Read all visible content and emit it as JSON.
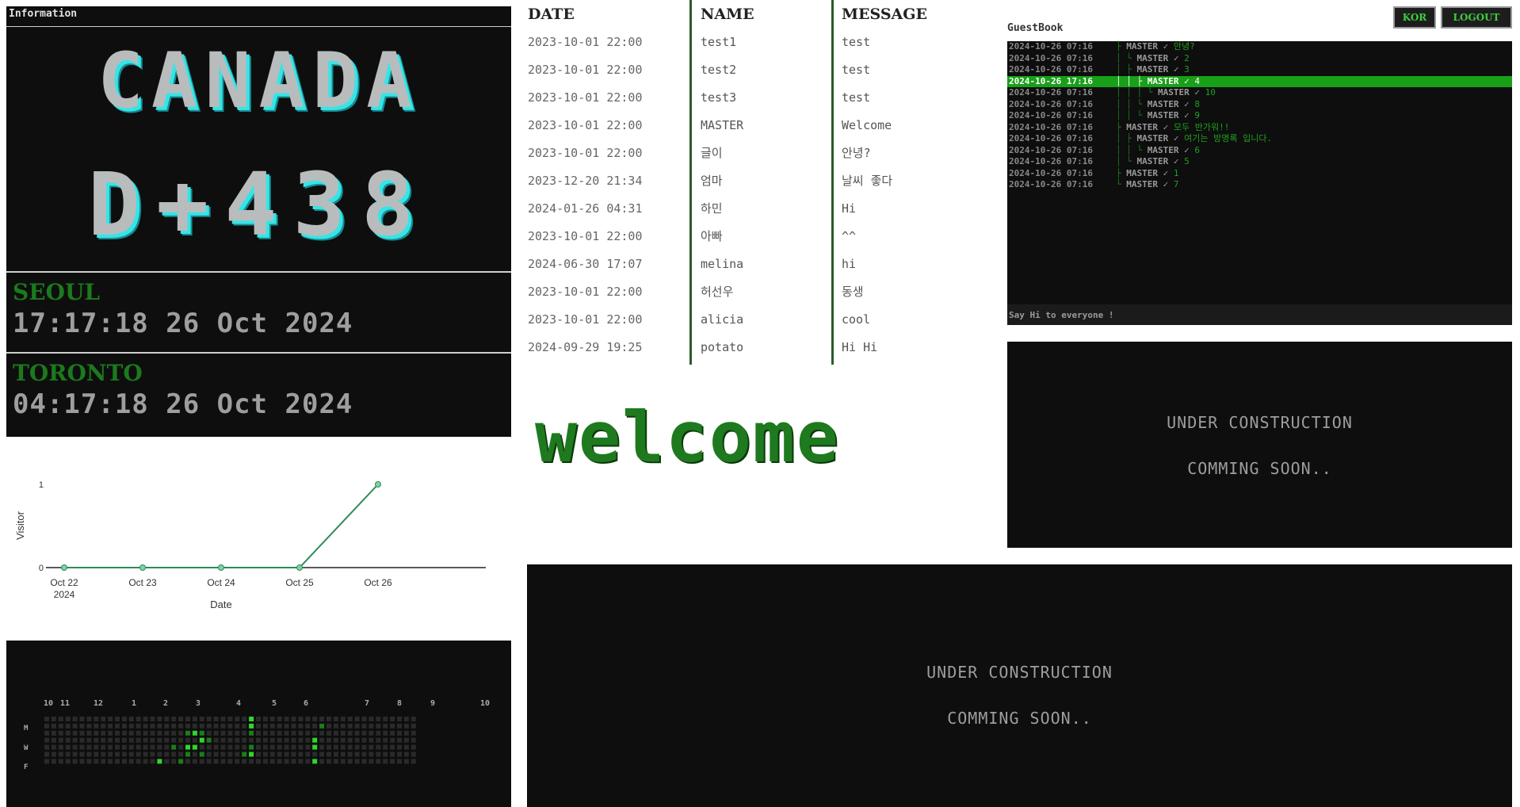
{
  "info": {
    "header": "Information",
    "banner_line1": "CANADA",
    "banner_line2": "D+438",
    "cities": [
      {
        "name": "SEOUL",
        "time": "17:17:18 26 Oct 2024"
      },
      {
        "name": "TORONTO",
        "time": "04:17:18 26 Oct 2024"
      }
    ]
  },
  "chart_data": {
    "type": "line",
    "categories": [
      "Oct 22",
      "Oct 23",
      "Oct 24",
      "Oct 25",
      "Oct 26"
    ],
    "x_sublabel": "2024",
    "values": [
      0,
      0,
      0,
      0,
      1
    ],
    "xlabel": "Date",
    "ylabel": "Visitor",
    "yticks": [
      0,
      1
    ],
    "ylim": [
      0,
      1
    ],
    "color": "#2e8b57"
  },
  "contrib": {
    "months": [
      "10",
      "11",
      "12",
      "1",
      "2",
      "3",
      "4",
      "5",
      "6",
      "7",
      "8",
      "9",
      "10"
    ],
    "days": [
      "M",
      "W",
      "F"
    ]
  },
  "table": {
    "headers": {
      "date": "DATE",
      "name": "NAME",
      "message": "MESSAGE"
    },
    "rows": [
      {
        "date": "2023-10-01 22:00",
        "name": "test1",
        "message": "test"
      },
      {
        "date": "2023-10-01 22:00",
        "name": "test2",
        "message": "test"
      },
      {
        "date": "2023-10-01 22:00",
        "name": "test3",
        "message": "test"
      },
      {
        "date": "2023-10-01 22:00",
        "name": "MASTER",
        "message": "Welcome"
      },
      {
        "date": "2023-10-01 22:00",
        "name": "글이",
        "message": "안녕?"
      },
      {
        "date": "2023-12-20 21:34",
        "name": "엄마",
        "message": "날씨 좋다"
      },
      {
        "date": "2024-01-26 04:31",
        "name": "하민",
        "message": "Hi"
      },
      {
        "date": "2023-10-01 22:00",
        "name": "아빠",
        "message": "^^"
      },
      {
        "date": "2024-06-30 17:07",
        "name": "melina",
        "message": "hi"
      },
      {
        "date": "2023-10-01 22:00",
        "name": "허선우",
        "message": "동생"
      },
      {
        "date": "2023-10-01 22:00",
        "name": "alicia",
        "message": "cool"
      },
      {
        "date": "2024-09-29 19:25",
        "name": "potato",
        "message": "Hi Hi"
      }
    ]
  },
  "welcome": "welcome",
  "buttons": {
    "kor": "KOR",
    "logout": "LOGOUT"
  },
  "guestbook": {
    "title": "GuestBook",
    "placeholder": "Say Hi to everyone !",
    "rows": [
      {
        "ts": "2024-10-26 07:16",
        "tree": "├ ",
        "who": "MASTER ✓ ",
        "msg": "안녕?"
      },
      {
        "ts": "2024-10-26 07:16",
        "tree": "│ └ ",
        "who": "MASTER ✓ ",
        "msg": "2"
      },
      {
        "ts": "2024-10-26 07:16",
        "tree": "│   ├ ",
        "who": "MASTER ✓ ",
        "msg": "3"
      },
      {
        "ts": "2024-10-26 17:16",
        "tree": "│   │ ├ ",
        "who": "MASTER ✓ ",
        "msg": "4",
        "active": true
      },
      {
        "ts": "2024-10-26 07:16",
        "tree": "│   │ │ └ ",
        "who": "MASTER ✓ ",
        "msg": "10"
      },
      {
        "ts": "2024-10-26 07:16",
        "tree": "│   │ └ ",
        "who": "MASTER ✓ ",
        "msg": "8"
      },
      {
        "ts": "2024-10-26 07:16",
        "tree": "│   │   └ ",
        "who": "MASTER ✓ ",
        "msg": "9"
      },
      {
        "ts": "2024-10-26 07:16",
        "tree": "├ ",
        "who": "MASTER ✓ ",
        "msg": "모두 반가워!!"
      },
      {
        "ts": "2024-10-26 07:16",
        "tree": "│ ├ ",
        "who": "MASTER ✓ ",
        "msg": "여기는 방명록 입니다."
      },
      {
        "ts": "2024-10-26 07:16",
        "tree": "│ │ └ ",
        "who": "MASTER ✓ ",
        "msg": "6"
      },
      {
        "ts": "2024-10-26 07:16",
        "tree": "│ └ ",
        "who": "MASTER ✓ ",
        "msg": "5"
      },
      {
        "ts": "2024-10-26 07:16",
        "tree": "├ ",
        "who": "MASTER ✓ ",
        "msg": "1"
      },
      {
        "ts": "2024-10-26 07:16",
        "tree": "└ ",
        "who": "MASTER ✓ ",
        "msg": "7"
      }
    ]
  },
  "construction": {
    "line1": "UNDER CONSTRUCTION",
    "line2": "COMMING SOON.."
  }
}
